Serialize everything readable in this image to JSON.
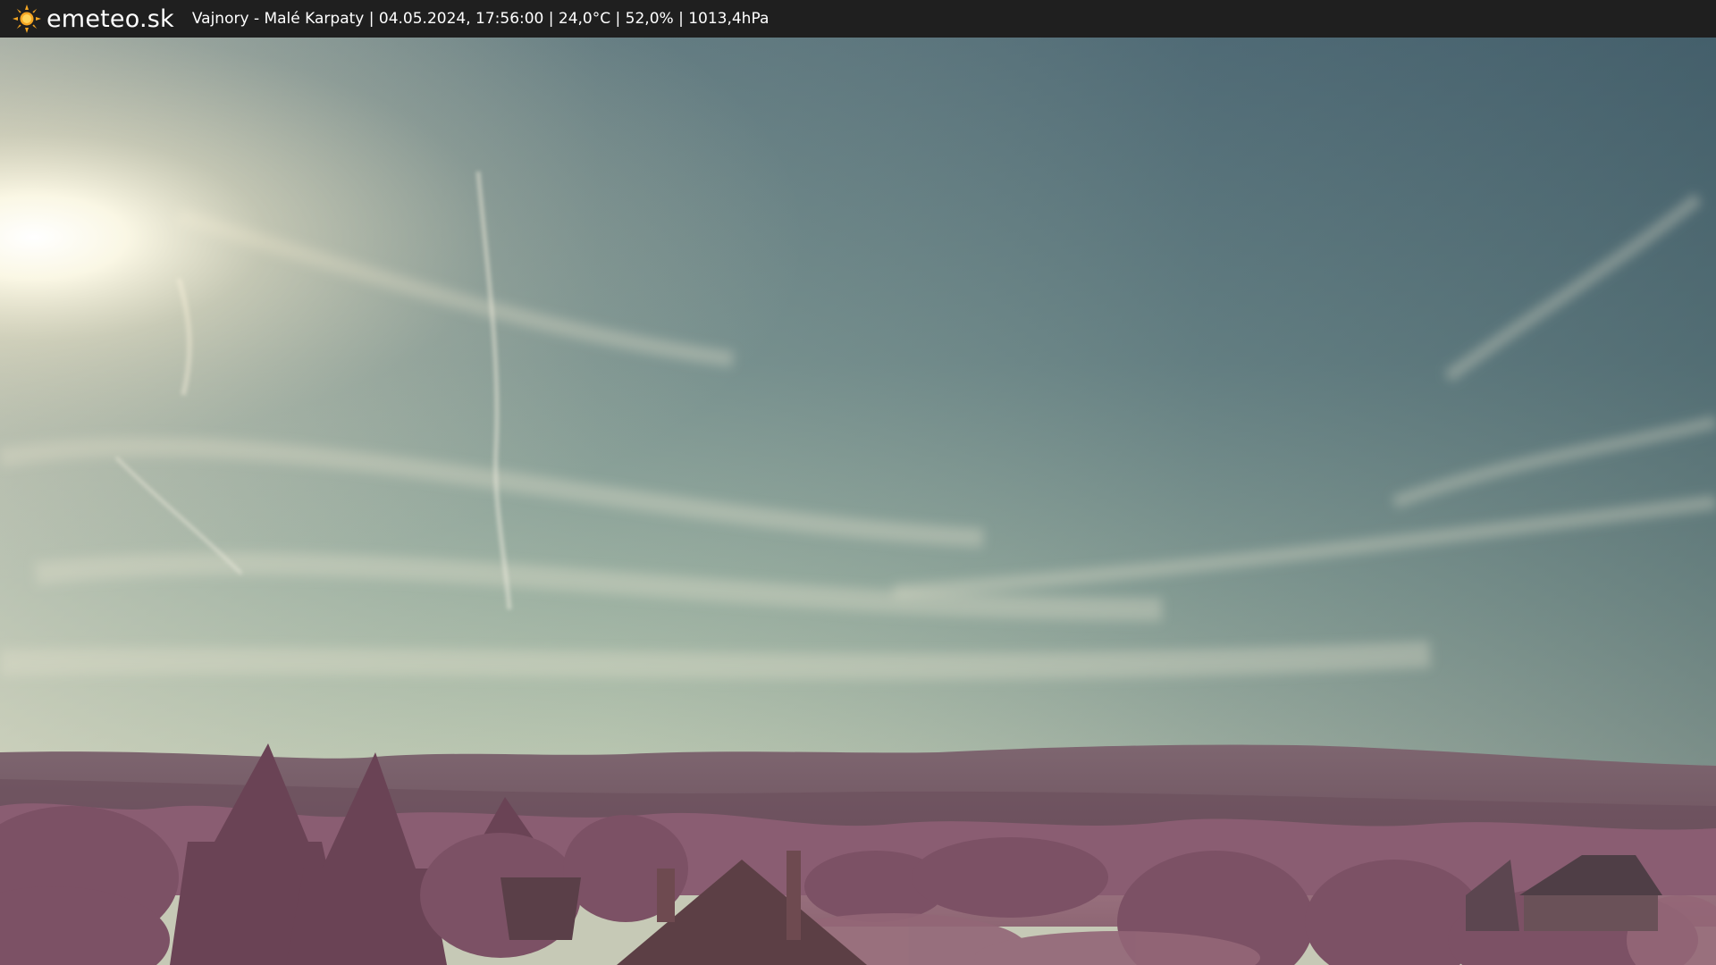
{
  "header": {
    "brand": "emeteo.sk",
    "brand_icon": "sun-icon",
    "caption": "Vajnory - Malé Karpaty | 04.05.2024, 17:56:00 | 24,0°C | 52,0% | 1013,4hPa"
  },
  "colors": {
    "bar_background": "#1f1f1f",
    "sun_icon": "#f5a623",
    "sky_top": "#4c6470",
    "sky_horizon": "#b9c8b4",
    "foliage": "#8a5a72"
  }
}
